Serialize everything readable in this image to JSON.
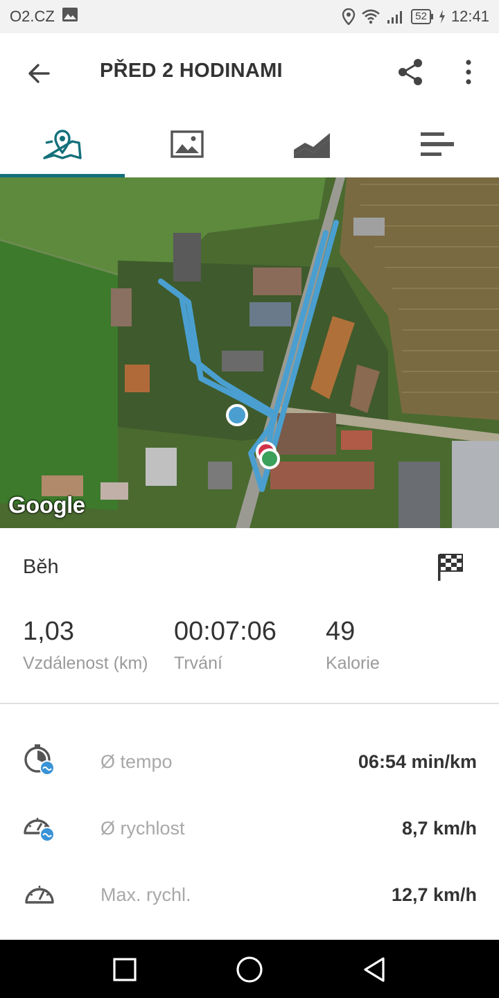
{
  "status_bar": {
    "carrier": "O2.CZ",
    "battery": "52",
    "time": "12:41"
  },
  "header": {
    "title": "PŘED 2 HODINAMI"
  },
  "tabs": [
    {
      "icon": "map-icon",
      "active": true
    },
    {
      "icon": "image-icon",
      "active": false
    },
    {
      "icon": "chart-icon",
      "active": false
    },
    {
      "icon": "splits-icon",
      "active": false
    }
  ],
  "map": {
    "attribution": "Google"
  },
  "activity": {
    "type": "Běh"
  },
  "stats": [
    {
      "value": "1,03",
      "label": "Vzdálenost (km)"
    },
    {
      "value": "00:07:06",
      "label": "Trvání"
    },
    {
      "value": "49",
      "label": "Kalorie"
    }
  ],
  "metrics": [
    {
      "icon": "avg-pace-icon",
      "label": "Ø tempo",
      "value": "06:54 min/km"
    },
    {
      "icon": "avg-speed-icon",
      "label": "Ø rychlost",
      "value": "8,7 km/h"
    },
    {
      "icon": "max-speed-icon",
      "label": "Max. rychl.",
      "value": "12,7 km/h"
    }
  ],
  "colors": {
    "accent": "#14707b",
    "route": "#4a9fd0",
    "start_marker": "#3aa05a",
    "end_marker": "#d0324a",
    "badge": "#3a93d6"
  }
}
